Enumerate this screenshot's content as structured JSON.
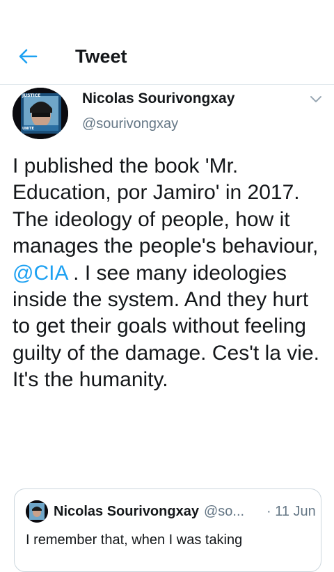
{
  "header": {
    "title": "Tweet",
    "back_icon": "arrow-left-icon",
    "accent_color": "#1da1f2"
  },
  "tweet": {
    "author": {
      "name": "Nicolas Sourivongxay",
      "handle": "@sourivongxay",
      "avatar_badge_top": "JUSTICE",
      "avatar_badge_bottom": "UNITE"
    },
    "caret_icon": "chevron-down-icon",
    "text_before_mention": "I published the book 'Mr. Education, por Jamiro' in 2017.\nThe ideology of people, how it manages the people's behaviour, ",
    "mention": "@CIA",
    "text_after_mention": " . I see many ideologies inside the system. And they hurt to get their goals without feeling guilty of the damage. Ces't la vie. It's the humanity."
  },
  "quoted_tweet": {
    "name": "Nicolas Sourivongxay",
    "handle": "@so...",
    "date": "· 11 Jun",
    "text": "I remember that, when I was taking"
  }
}
